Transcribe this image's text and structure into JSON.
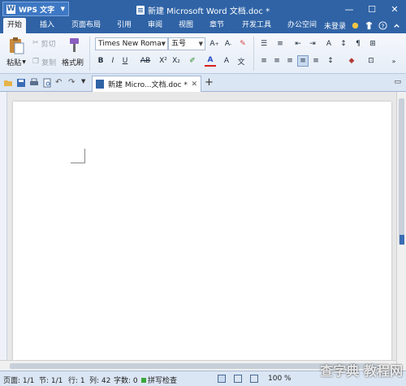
{
  "app": {
    "name": "WPS 文字"
  },
  "window": {
    "title": "新建 Microsoft Word 文档.doc *"
  },
  "menu_tabs": [
    "开始",
    "插入",
    "页面布局",
    "引用",
    "审阅",
    "视图",
    "章节",
    "开发工具",
    "办公空间"
  ],
  "account": {
    "login_label": "未登录"
  },
  "ribbon": {
    "paste_label": "粘贴",
    "cut_label": "剪切",
    "copy_label": "复制",
    "format_painter_label": "格式刷",
    "font_name": "Times New Roma",
    "font_size": "五号"
  },
  "document_tab": {
    "label": "新建 Micro...文档.doc *"
  },
  "status": {
    "page": "页面: 1/1",
    "section": "节: 1/1",
    "line": "行: 1",
    "column": "列: 42",
    "word_count": "字数: 0",
    "spell_check": "拼写检查",
    "zoom": "100 %"
  },
  "watermark": "查字典 教程网",
  "colors": {
    "title_bar": "#2f63a6",
    "ribbon_bg": "#eef3fa",
    "accent": "#3e78c4"
  }
}
